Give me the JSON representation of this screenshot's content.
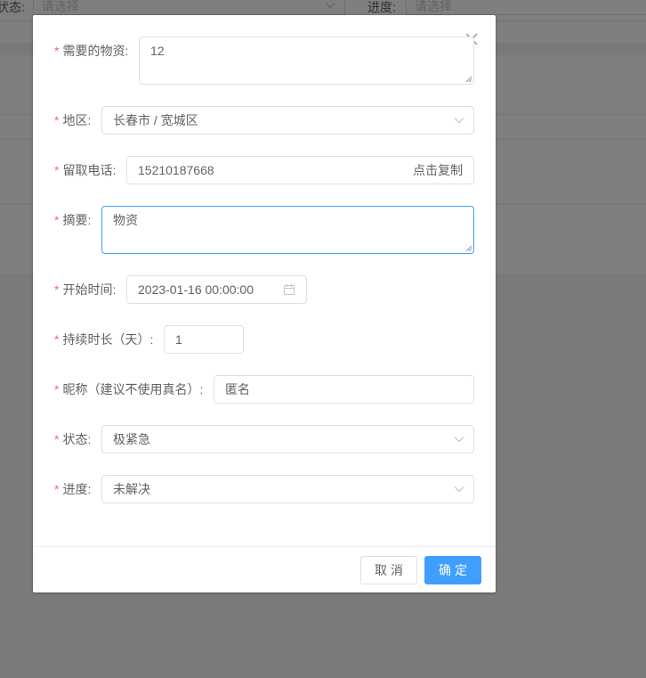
{
  "background": {
    "filter_status_label": "状态:",
    "filter_status_placeholder": "请选择",
    "filter_progress_label": "进度:",
    "filter_progress_placeholder": "请选择"
  },
  "dialog": {
    "close_icon": "close-icon",
    "fields": {
      "materials": {
        "label": "需要的物资:",
        "value": "12"
      },
      "region": {
        "label": "地区:",
        "value": "长春市 / 宽城区"
      },
      "phone": {
        "label": "留取电话:",
        "value": "15210187668",
        "append": "点击复制"
      },
      "summary": {
        "label": "摘要:",
        "value": "物资"
      },
      "start_time": {
        "label": "开始时间:",
        "value": "2023-01-16 00:00:00"
      },
      "duration": {
        "label": "持续时长（天）:",
        "value": "1"
      },
      "nickname": {
        "label": "昵称（建议不使用真名）:",
        "value": "匿名"
      },
      "status": {
        "label": "状态:",
        "value": "极紧急"
      },
      "progress": {
        "label": "进度:",
        "value": "未解决"
      }
    },
    "required_mark": "*",
    "buttons": {
      "cancel": "取消",
      "confirm": "确定"
    }
  },
  "colors": {
    "primary": "#409eff",
    "required": "#f56c6c",
    "border": "#dcdfe6",
    "text": "#606266"
  }
}
